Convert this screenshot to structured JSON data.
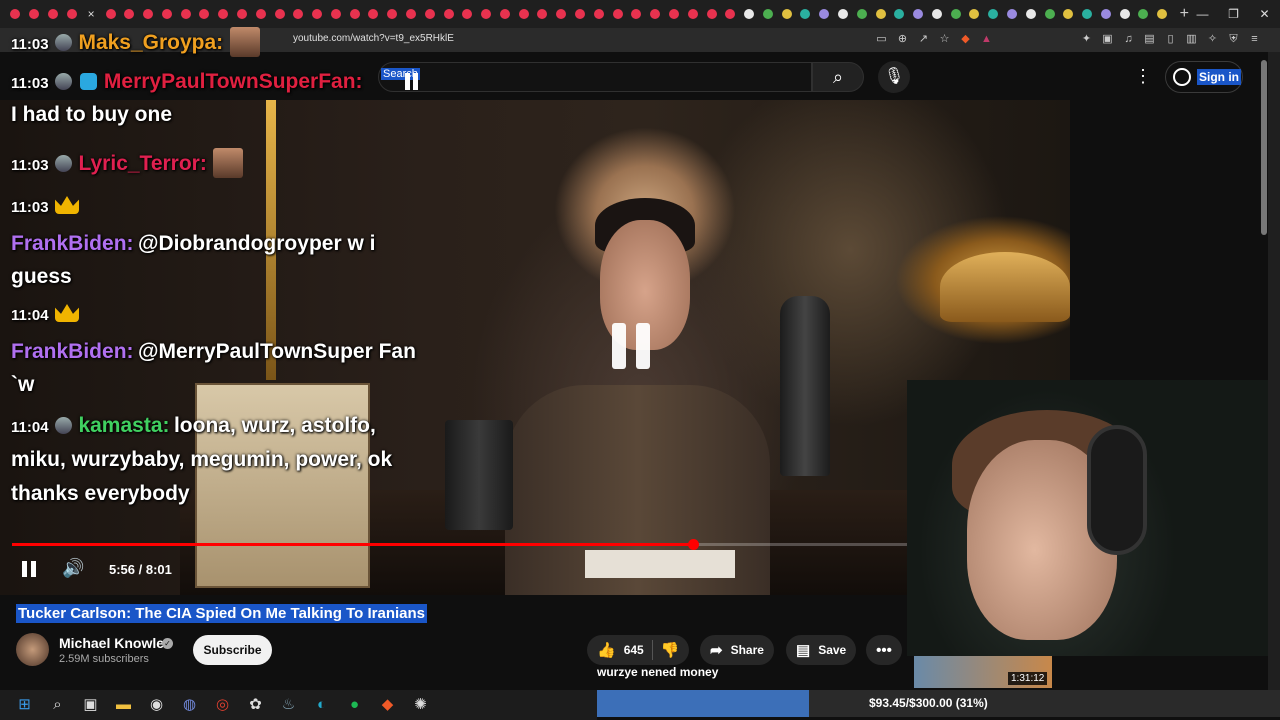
{
  "browser": {
    "url": "youtube.com/watch?v=t9_ex5RHklE",
    "new_tab": "+",
    "close_tab": "×",
    "window_controls": {
      "minimize": "—",
      "maximize": "❐",
      "close": "✕"
    }
  },
  "masthead": {
    "search_label": "Search",
    "signin_label": "Sign in"
  },
  "chat": {
    "messages": [
      {
        "time": "11:03",
        "name": "Maks_Groypa:",
        "name_color": "#f0a020",
        "text": ""
      },
      {
        "time": "11:03",
        "name": "MerryPaulTownSuperFan:",
        "name_color": "#e02040",
        "text": "I had to buy one"
      },
      {
        "time": "11:03",
        "name": "Lyric_Terror:",
        "name_color": "#e02050",
        "text": ""
      },
      {
        "time": "11:03",
        "name": "FrankBiden:",
        "name_color": "#b070f0",
        "text": "@Diobrandogroyper w i guess"
      },
      {
        "time": "11:04",
        "name": "FrankBiden:",
        "name_color": "#b070f0",
        "text": "@MerryPaulTownSuper Fan `w"
      },
      {
        "time": "11:04",
        "name": "kamasta:",
        "name_color": "#40d060",
        "text": "loona, wurz, astolfo, miku, wurzybaby, megumin, power, ok thanks everybody"
      }
    ]
  },
  "player": {
    "current_time": "5:56 / 8:01",
    "progress_fraction": 0.74
  },
  "video": {
    "title": "Tucker Carlson: The CIA Spied On Me Talking To Iranians",
    "channel": "Michael Knowles",
    "subscribers": "2.59M subscribers",
    "subscribe_label": "Subscribe",
    "likes": "645",
    "share_label": "Share",
    "save_label": "Save"
  },
  "donation": {
    "label": "wurzye nened money",
    "progress_text": "$93.45/$300.00 (31%)",
    "fraction": 0.31
  },
  "sidebar": {
    "thumb_duration": "1:31:12"
  },
  "colors": {
    "accent_red": "#ff0000",
    "selection_blue": "#1a56c8"
  }
}
